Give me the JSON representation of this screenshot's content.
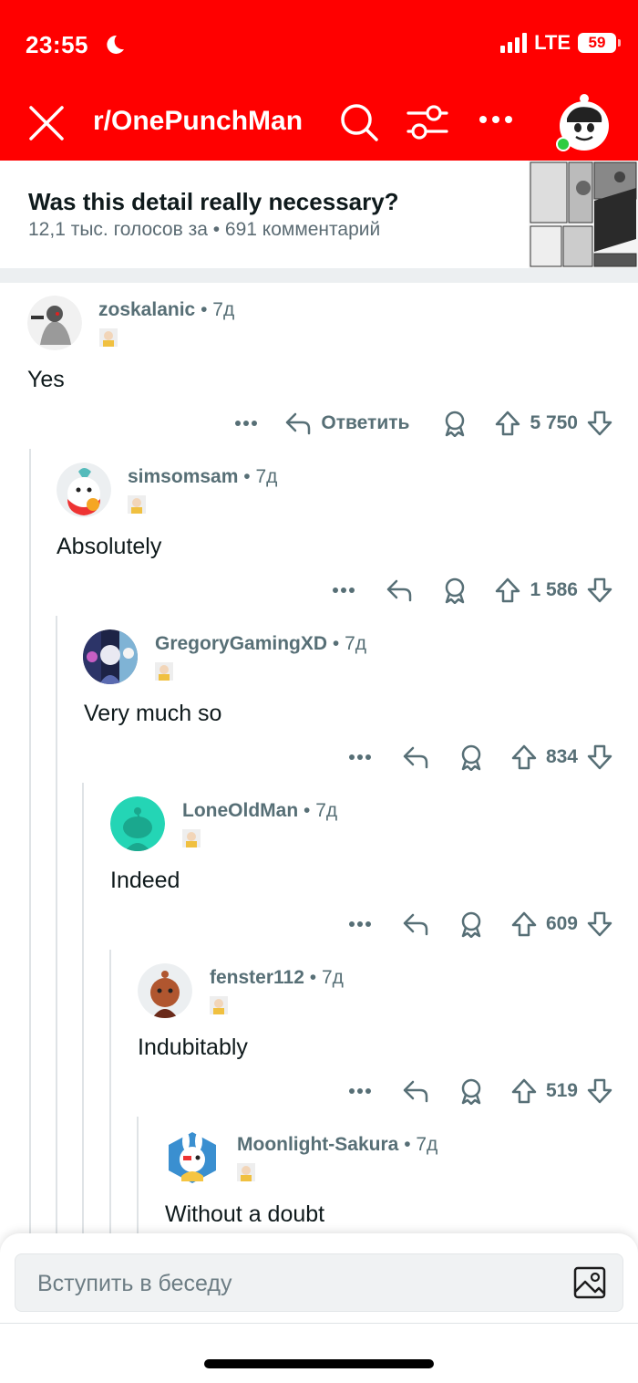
{
  "status_bar": {
    "time": "23:55",
    "network": "LTE",
    "battery": "59"
  },
  "header": {
    "subreddit": "r/OnePunchMan"
  },
  "post": {
    "title": "Was this detail really necessary?",
    "meta": "12,1 тыс. голосов за • 691 комментарий"
  },
  "comments": [
    {
      "user": "zoskalanic",
      "time": "7д",
      "body": "Yes",
      "reply_label": "Ответить",
      "score": "5 750"
    },
    {
      "user": "simsomsam",
      "time": "7д",
      "body": "Absolutely",
      "score": "1 586"
    },
    {
      "user": "GregoryGamingXD",
      "time": "7д",
      "body": "Very much so",
      "score": "834"
    },
    {
      "user": "LoneOldMan",
      "time": "7д",
      "body": "Indeed",
      "score": "609"
    },
    {
      "user": "fenster112",
      "time": "7д",
      "body": "Indubitably",
      "score": "519"
    },
    {
      "user": "Moonlight-Sakura",
      "time": "7д",
      "body": "Without a doubt"
    }
  ],
  "composer": {
    "placeholder": "Вступить в беседу"
  },
  "colors": {
    "brand_red": "#ff0000",
    "meta_gray": "#576f76",
    "thread_line": "#dfe3e6"
  }
}
